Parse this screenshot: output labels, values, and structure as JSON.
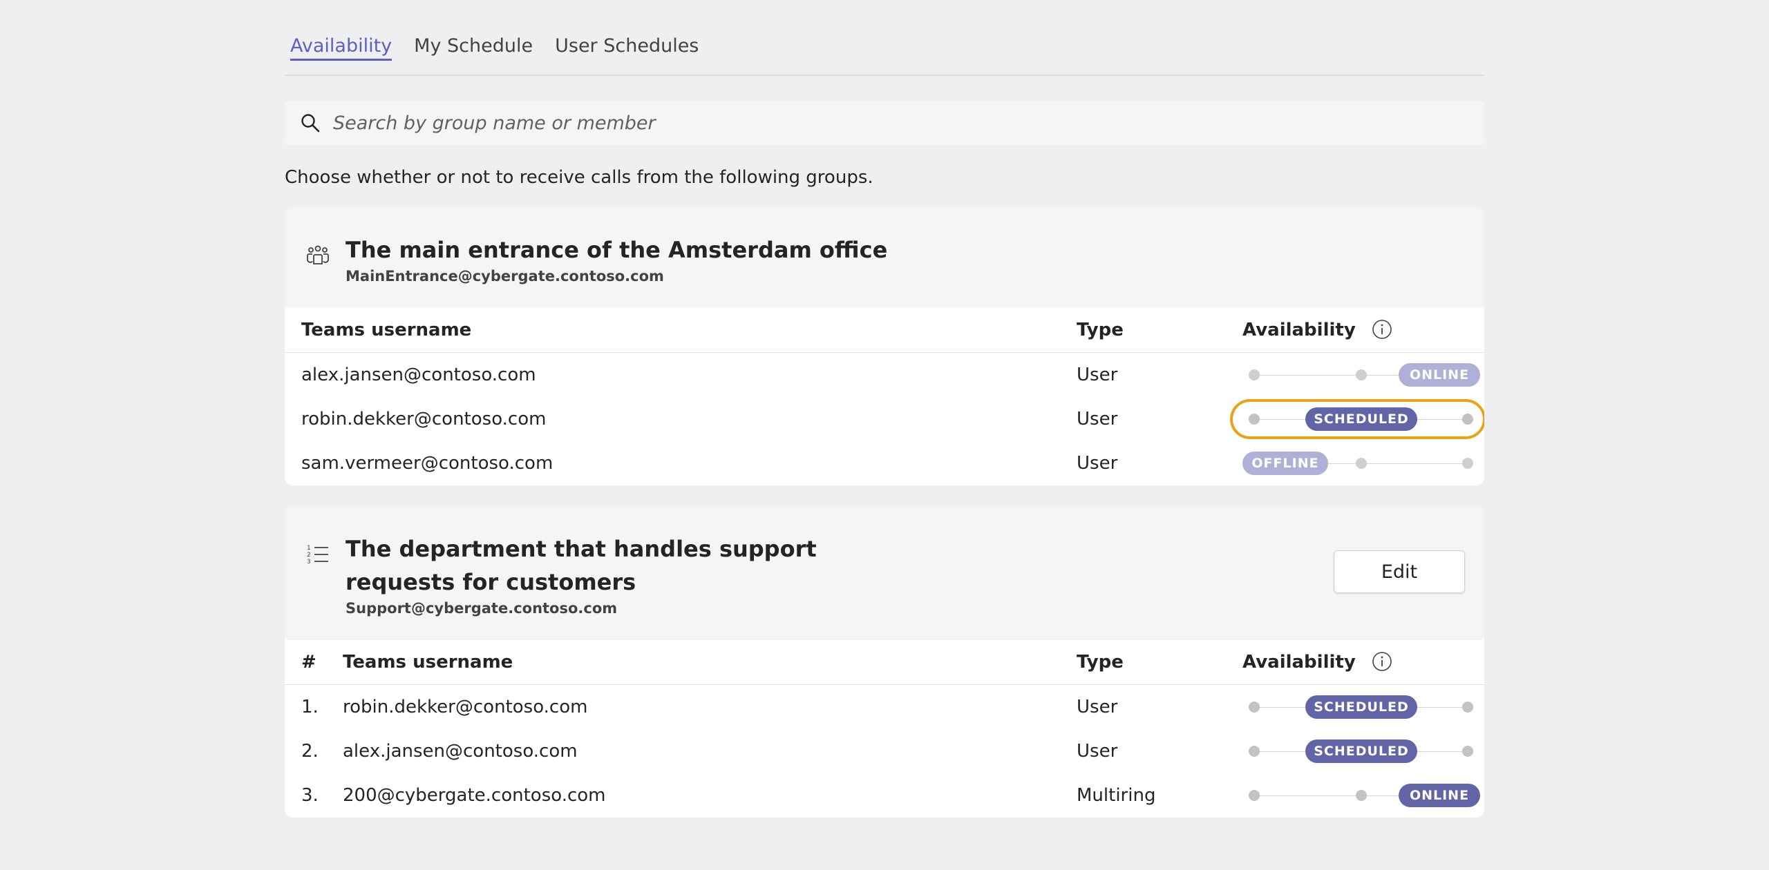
{
  "tabs": [
    {
      "label": "Availability",
      "active": true
    },
    {
      "label": "My Schedule",
      "active": false
    },
    {
      "label": "User Schedules",
      "active": false
    }
  ],
  "search": {
    "placeholder": "Search by group name or member",
    "icon": "search-icon"
  },
  "intro": "Choose whether or not to receive calls from the following groups.",
  "groups": [
    {
      "title": "The main entrance of the Amsterdam office",
      "email": "MainEntrance@cybergate.contoso.com",
      "icon": "people-group-icon",
      "columns": {
        "username": "Teams username",
        "type": "Type",
        "availability": "Availability"
      },
      "rows": [
        {
          "username": "alex.jansen@contoso.com",
          "type": "User",
          "availability": "ONLINE",
          "position": 2,
          "muted": true
        },
        {
          "username": "robin.dekker@contoso.com",
          "type": "User",
          "availability": "SCHEDULED",
          "position": 1,
          "muted": false,
          "focused": true
        },
        {
          "username": "sam.vermeer@contoso.com",
          "type": "User",
          "availability": "OFFLINE",
          "position": 0,
          "muted": true
        }
      ]
    },
    {
      "title": "The department that handles support requests for customers",
      "email": "Support@cybergate.contoso.com",
      "icon": "numbered-list-icon",
      "edit_label": "Edit",
      "columns": {
        "number": "#",
        "username": "Teams username",
        "type": "Type",
        "availability": "Availability"
      },
      "rows": [
        {
          "number": "1.",
          "username": "robin.dekker@contoso.com",
          "type": "User",
          "availability": "SCHEDULED",
          "position": 1,
          "muted": false
        },
        {
          "number": "2.",
          "username": "alex.jansen@contoso.com",
          "type": "User",
          "availability": "SCHEDULED",
          "position": 1,
          "muted": false
        },
        {
          "number": "3.",
          "username": "200@cybergate.contoso.com",
          "type": "Multiring",
          "availability": "ONLINE",
          "position": 2,
          "muted": false
        }
      ]
    }
  ],
  "colors": {
    "accent": "#5b5fc7",
    "pill": "#6264a7",
    "pill_muted": "#aeb0d8",
    "focus_ring": "#e8a317"
  }
}
